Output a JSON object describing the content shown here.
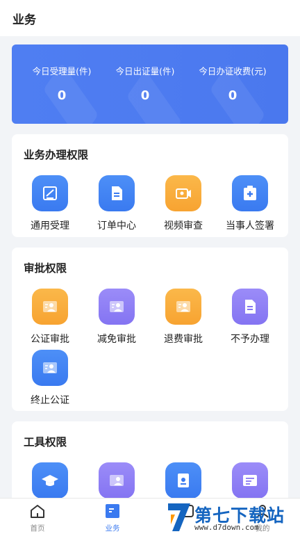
{
  "header": {
    "title": "业务"
  },
  "stats": [
    {
      "label": "今日受理量(件)",
      "value": "0"
    },
    {
      "label": "今日出证量(件)",
      "value": "0"
    },
    {
      "label": "今日办证收费(元)",
      "value": "0"
    }
  ],
  "business": {
    "title": "业务办理权限",
    "items": [
      {
        "label": "通用受理",
        "icon": "edit-document-icon",
        "color": "#3a7af0"
      },
      {
        "label": "订单中心",
        "icon": "document-icon",
        "color": "#3a7af0"
      },
      {
        "label": "视频审查",
        "icon": "video-camera-icon",
        "color": "#f7a331"
      },
      {
        "label": "当事人签署",
        "icon": "clipboard-plus-icon",
        "color": "#3a7af0"
      }
    ]
  },
  "approval": {
    "title": "审批权限",
    "items": [
      {
        "label": "公证审批",
        "icon": "id-card-icon",
        "color": "#f7a331"
      },
      {
        "label": "减免审批",
        "icon": "id-card-icon",
        "color": "#8474f2"
      },
      {
        "label": "退费审批",
        "icon": "id-card-icon",
        "color": "#f7a331"
      },
      {
        "label": "不予办理",
        "icon": "document-icon",
        "color": "#8474f2"
      },
      {
        "label": "终止公证",
        "icon": "id-card-icon",
        "color": "#3a7af0"
      }
    ]
  },
  "tools": {
    "title": "工具权限",
    "items": [
      {
        "icon": "graduation-cap-icon",
        "color": "#3a7af0"
      },
      {
        "icon": "id-card-icon",
        "color": "#8474f2"
      },
      {
        "icon": "certificate-icon",
        "color": "#3a7af0"
      },
      {
        "icon": "id-card-icon",
        "color": "#8474f2"
      }
    ]
  },
  "tabbar": {
    "tabs": [
      {
        "label": "首页",
        "icon": "home-icon"
      },
      {
        "label": "业务",
        "icon": "business-icon",
        "active": true
      },
      {
        "label": "",
        "icon": "tab-icon"
      },
      {
        "label": "我的",
        "icon": "user-icon"
      }
    ],
    "active_color": "#3a7af0"
  },
  "watermark": {
    "main": "第七下载站",
    "sub": "www.d7down.com"
  }
}
